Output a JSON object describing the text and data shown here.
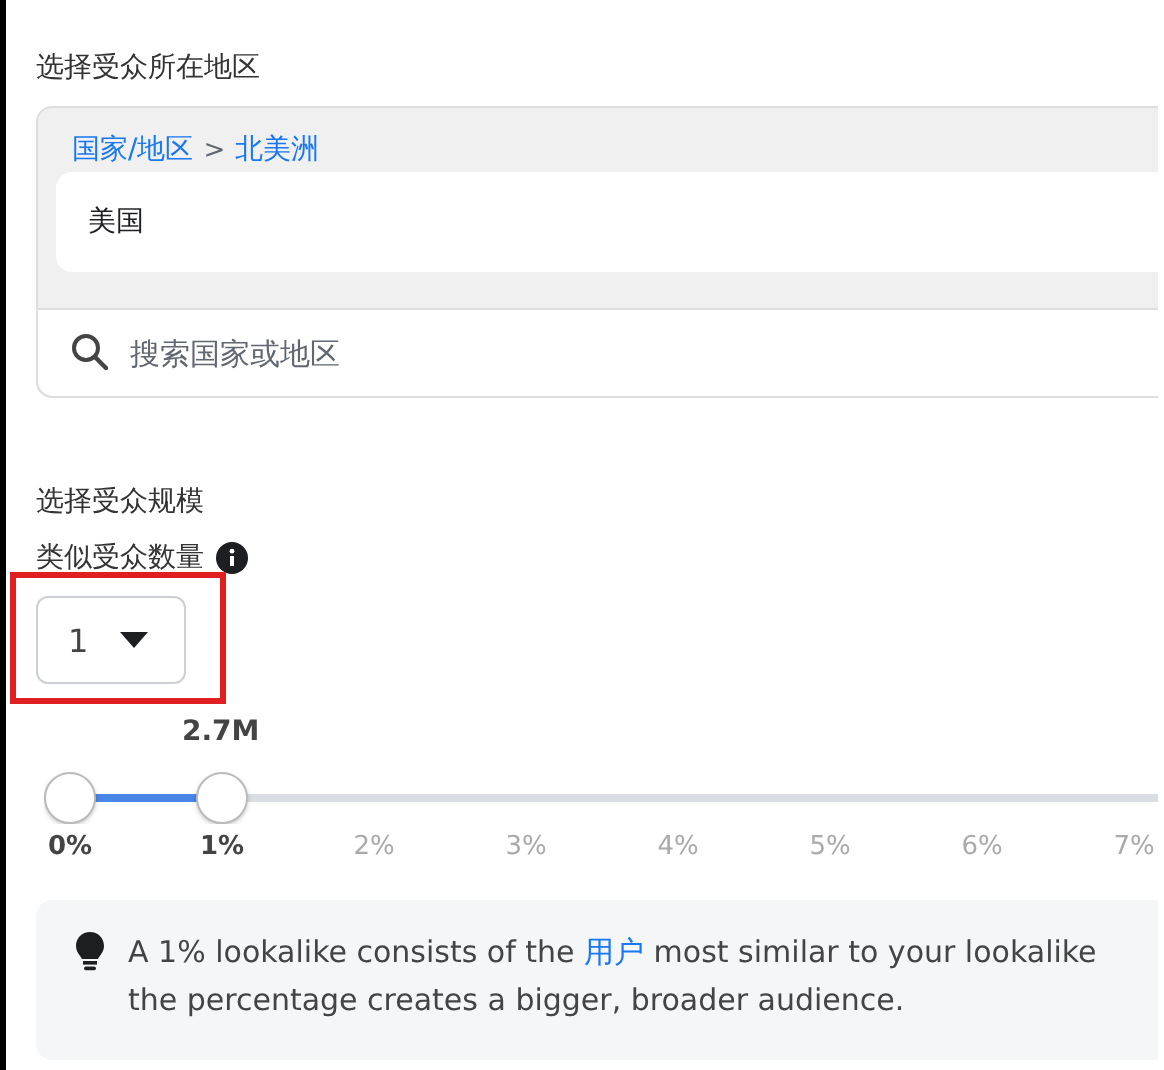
{
  "region": {
    "title": "选择受众所在地区",
    "breadcrumb": [
      {
        "label": "国家/地区"
      },
      {
        "label": "北美洲"
      }
    ],
    "separator": ">",
    "selected_location": "美国",
    "search": {
      "placeholder": "搜索国家或地区"
    }
  },
  "size": {
    "title": "选择受众规模",
    "count_label": "类似受众数量",
    "dropdown": {
      "value": "1"
    },
    "highlighted": true,
    "reading": "2.7M",
    "range": {
      "low": {
        "level": 0
      },
      "high": {
        "level": 0.1
      }
    },
    "ticks": [
      {
        "label": "0%",
        "selected": true
      },
      {
        "label": "1%",
        "selected": true
      },
      {
        "label": "2%",
        "selected": false
      },
      {
        "label": "3%",
        "selected": false
      },
      {
        "label": "4%",
        "selected": false
      },
      {
        "label": "5%",
        "selected": false
      },
      {
        "label": "6%",
        "selected": false
      },
      {
        "label": "7%",
        "selected": false
      }
    ]
  },
  "tip": {
    "before": "A 1% lookalike consists of the ",
    "link": "用户",
    "after": " most similar to your lookalike",
    "line2": "the percentage creates a bigger, broader audience."
  }
}
